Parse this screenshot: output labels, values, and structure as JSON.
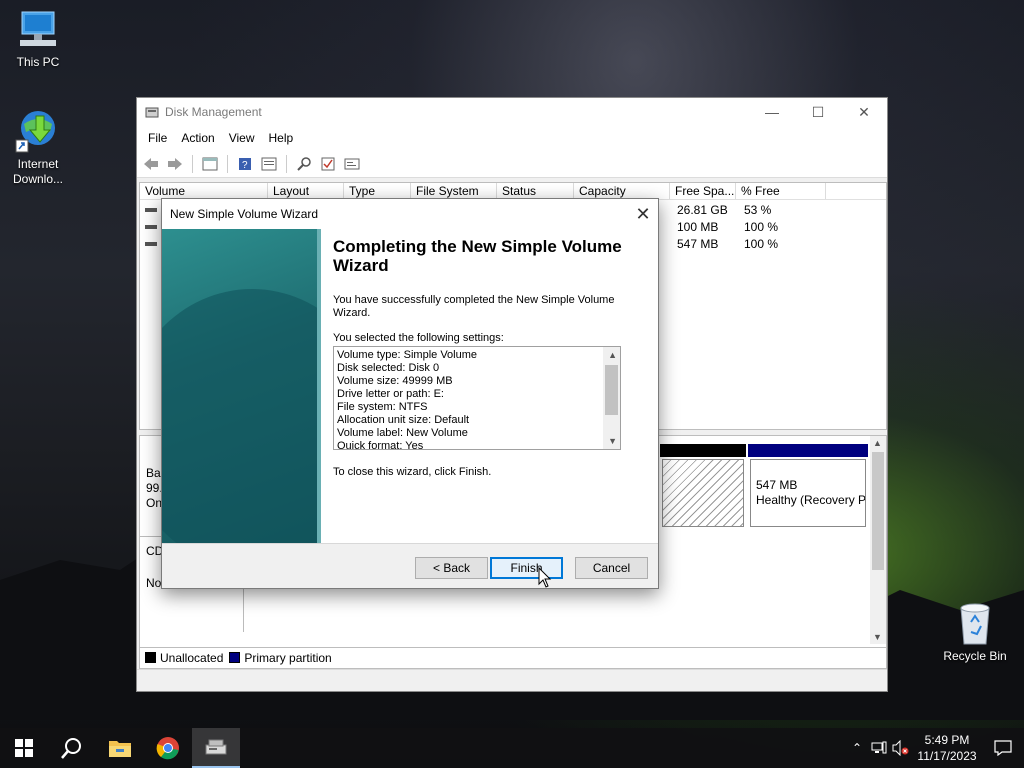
{
  "desktop": {
    "icons": [
      {
        "label": "This PC"
      },
      {
        "label": "Internet Downlo..."
      },
      {
        "label": "Recycle Bin"
      }
    ]
  },
  "window": {
    "title": "Disk Management",
    "menu": [
      "File",
      "Action",
      "View",
      "Help"
    ],
    "columns": [
      "Volume",
      "Layout",
      "Type",
      "File System",
      "Status",
      "Capacity",
      "Free Spa...",
      "% Free"
    ],
    "rows": [
      {
        "free": "26.81 GB",
        "pct": "53 %"
      },
      {
        "free": "100 MB",
        "pct": "100 %"
      },
      {
        "free": "547 MB",
        "pct": "100 %"
      }
    ],
    "disk_fragments": [
      "Ba",
      "99.",
      "On",
      "CD",
      "No Media"
    ],
    "recovery_partition": {
      "size": "547 MB",
      "status": "Healthy (Recovery P"
    },
    "legend": [
      "Unallocated",
      "Primary partition"
    ],
    "colors": {
      "unallocated": "#000000",
      "primary": "#00007f"
    }
  },
  "dialog": {
    "title": "New Simple Volume Wizard",
    "heading": "Completing the New Simple Volume Wizard",
    "intro": "You have successfully completed the New Simple Volume Wizard.",
    "settings_label": "You selected the following settings:",
    "settings": [
      "Volume type: Simple Volume",
      "Disk selected: Disk 0",
      "Volume size: 49999 MB",
      "Drive letter or path: E:",
      "File system: NTFS",
      "Allocation unit size: Default",
      "Volume label: New Volume",
      "Quick format: Yes"
    ],
    "close_hint": "To close this wizard, click Finish.",
    "buttons": {
      "back": "< Back",
      "finish": "Finish",
      "cancel": "Cancel"
    }
  },
  "taskbar": {
    "time": "5:49 PM",
    "date": "11/17/2023"
  }
}
